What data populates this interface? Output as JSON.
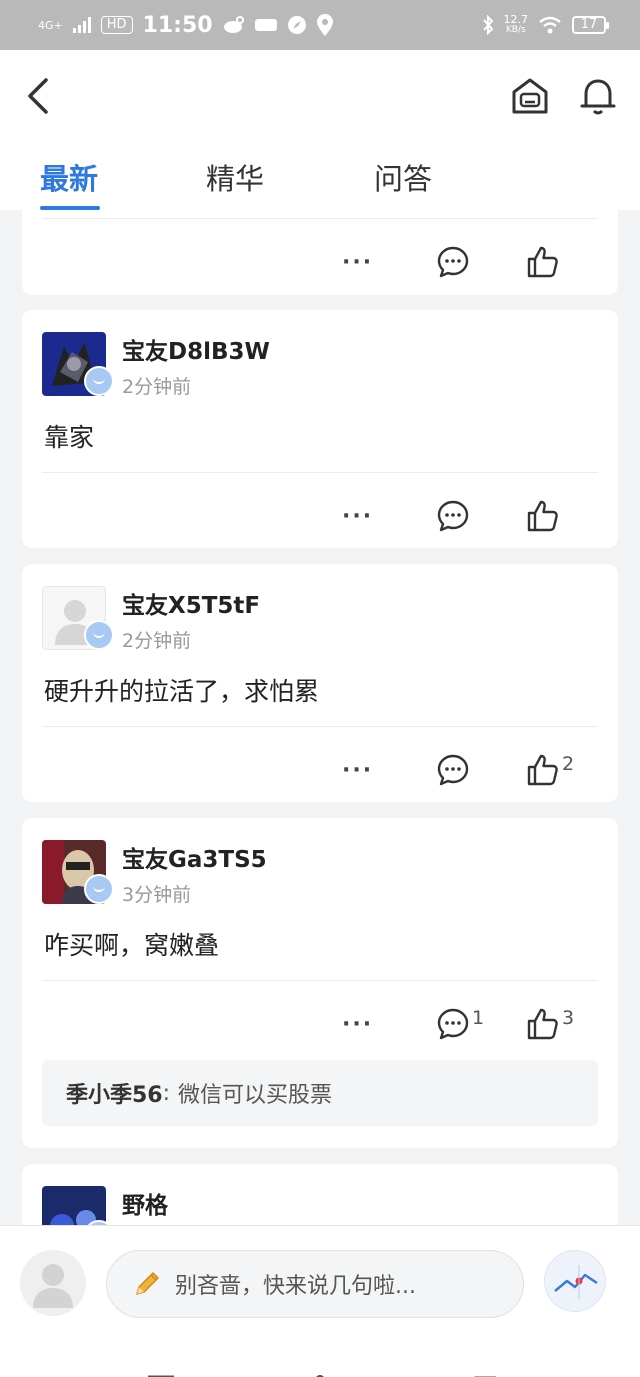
{
  "status_bar": {
    "network": "4G+",
    "hd": "HD",
    "time": "11:50",
    "speed_value": "12.7",
    "speed_unit": "KB/s",
    "battery": "17"
  },
  "tabs": [
    {
      "label": "最新",
      "active": true
    },
    {
      "label": "精华",
      "active": false
    },
    {
      "label": "问答",
      "active": false
    }
  ],
  "posts": [
    {
      "user": "宝友D8lB3W",
      "time": "2分钟前",
      "content": "靠家",
      "comments": "",
      "likes": ""
    },
    {
      "user": "宝友X5T5tF",
      "time": "2分钟前",
      "content": "硬升升的拉活了，求怕累",
      "comments": "",
      "likes": "2"
    },
    {
      "user": "宝友Ga3TS5",
      "time": "3分钟前",
      "content": "咋买啊，窝嫩叠",
      "comments": "1",
      "likes": "3",
      "reply": {
        "user": "季小季56",
        "colon": ":",
        "text": "微信可以买股票"
      }
    },
    {
      "user": "野格"
    }
  ],
  "more_label": "···",
  "bottom": {
    "placeholder": "别吝啬，快来说几句啦..."
  },
  "colors": {
    "accent": "#2f78e0",
    "page_bg": "#f2f3f5"
  }
}
